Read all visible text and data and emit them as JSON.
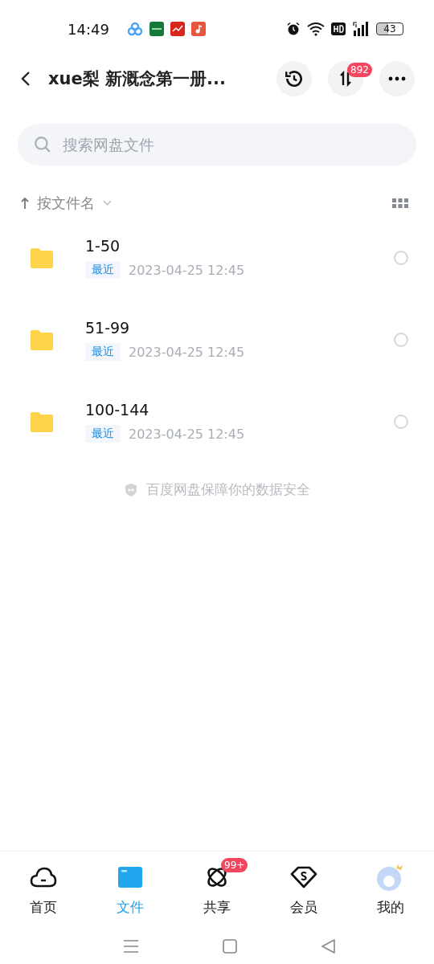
{
  "status_bar": {
    "time": "14:49",
    "battery": "43"
  },
  "header": {
    "title": "xue梨 新溉念第一册...",
    "transfer_badge": "892"
  },
  "search": {
    "placeholder": "搜索网盘文件"
  },
  "sort": {
    "label": "按文件名"
  },
  "files": [
    {
      "name": "1-50",
      "tag": "最近",
      "date": "2023-04-25  12:45",
      "selected": false
    },
    {
      "name": "51-99",
      "tag": "最近",
      "date": "2023-04-25  12:45",
      "selected": false
    },
    {
      "name": "100-144",
      "tag": "最近",
      "date": "2023-04-25  12:45",
      "selected": false
    }
  ],
  "footer_note": "百度网盘保障你的数据安全",
  "tabs": [
    {
      "kind": "home",
      "label": "首页",
      "selected": false
    },
    {
      "kind": "files",
      "label": "文件",
      "selected": true
    },
    {
      "kind": "share",
      "label": "共享",
      "selected": false,
      "badge": "99+"
    },
    {
      "kind": "vip",
      "label": "会员",
      "selected": false
    },
    {
      "kind": "me",
      "label": "我的",
      "selected": false
    }
  ]
}
